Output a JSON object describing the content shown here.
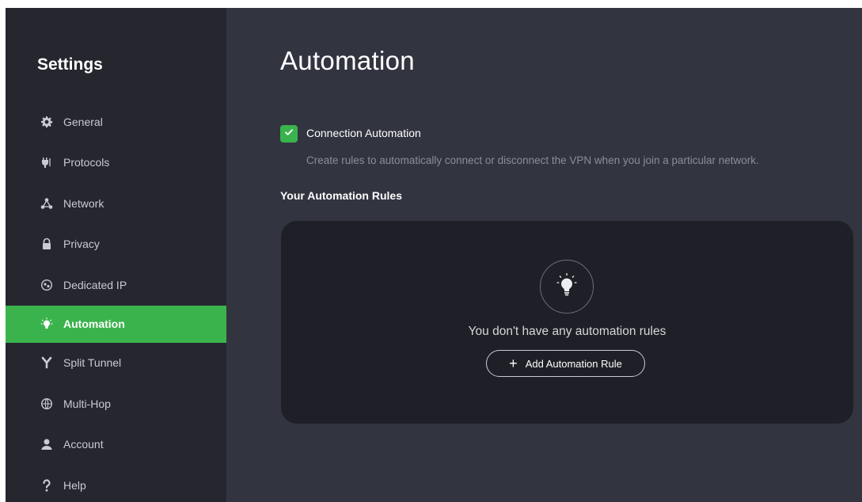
{
  "sidebar": {
    "title": "Settings",
    "items": [
      {
        "label": "General",
        "icon": "gear-icon"
      },
      {
        "label": "Protocols",
        "icon": "plug-icon"
      },
      {
        "label": "Network",
        "icon": "network-icon"
      },
      {
        "label": "Privacy",
        "icon": "lock-icon"
      },
      {
        "label": "Dedicated IP",
        "icon": "dedicated-ip-icon"
      },
      {
        "label": "Automation",
        "icon": "lightbulb-icon",
        "active": true
      },
      {
        "label": "Split Tunnel",
        "icon": "split-tunnel-icon"
      },
      {
        "label": "Multi-Hop",
        "icon": "globe-icon"
      },
      {
        "label": "Account",
        "icon": "user-icon"
      },
      {
        "label": "Help",
        "icon": "question-icon"
      }
    ]
  },
  "main": {
    "title": "Automation",
    "connection_automation": {
      "label": "Connection Automation",
      "checked": true,
      "description": "Create rules to automatically connect or disconnect the VPN when you join a particular network."
    },
    "rules_heading": "Your Automation Rules",
    "empty_state": {
      "icon": "lightbulb-icon",
      "text": "You don't have any automation rules",
      "add_button_label": "Add Automation Rule"
    }
  },
  "colors": {
    "accent": "#3bb34d",
    "sidebar_bg": "#25262e",
    "main_bg": "#323540",
    "panel_bg": "#1f2027"
  }
}
